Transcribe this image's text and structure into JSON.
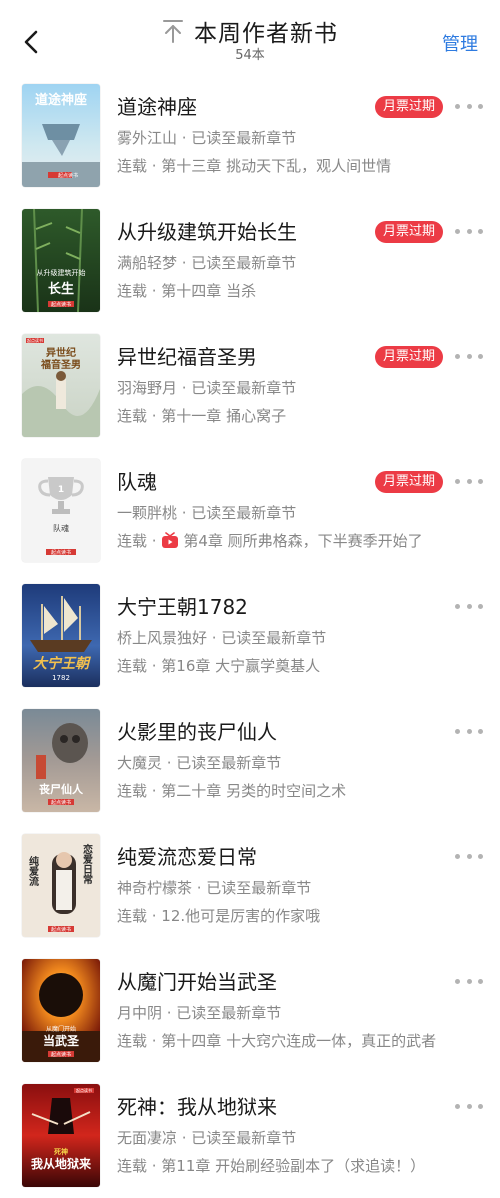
{
  "header": {
    "title": "本周作者新书",
    "count": "54本",
    "manage_label": "管理",
    "back_icon": "chevron-left-icon",
    "totop_icon": "arrow-up-bar-icon"
  },
  "colors": {
    "badge": "#ec3b45",
    "accent": "#2e7be0",
    "meta_text": "#888888"
  },
  "books": [
    {
      "title": "道途神座",
      "author_status": "雾外江山 · 已读至最新章节",
      "chapter": "连载 · 第十三章 挑动天下乱，观人间世情",
      "badge": "月票过期",
      "cover_text": "道途神座",
      "cover_logo": "起点读书",
      "video_icon": false
    },
    {
      "title": "从升级建筑开始长生",
      "author_status": "满船轻梦 · 已读至最新章节",
      "chapter": "连载 · 第十四章 当杀",
      "badge": "月票过期",
      "cover_text": "从升级建筑开始",
      "cover_text2": "长生",
      "cover_logo": "起点读书",
      "video_icon": false
    },
    {
      "title": "异世纪福音圣男",
      "author_status": "羽海野月 · 已读至最新章节",
      "chapter": "连载 · 第十一章 捅心窝子",
      "badge": "月票过期",
      "cover_text": "异世纪",
      "cover_text2": "福音圣男",
      "cover_logo": "起点读书",
      "video_icon": false
    },
    {
      "title": "队魂",
      "author_status": "一颗胖桃 · 已读至最新章节",
      "chapter": "第4章 厕所弗格森，下半赛季开始了",
      "chapter_prefix": "连载 · ",
      "badge": "月票过期",
      "cover_text": "队魂",
      "cover_logo": "起点读书",
      "video_icon": true
    },
    {
      "title": "大宁王朝1782",
      "author_status": "桥上风景独好 · 已读至最新章节",
      "chapter": "连载 · 第16章 大宁赢学奠基人",
      "badge": "",
      "cover_text": "大宁王朝",
      "cover_text2": "1782",
      "video_icon": false
    },
    {
      "title": "火影里的丧尸仙人",
      "author_status": "大魔灵 · 已读至最新章节",
      "chapter": "连载 · 第二十章 另类的时空间之术",
      "badge": "",
      "cover_text": "丧尸仙人",
      "cover_logo": "起点读书",
      "video_icon": false
    },
    {
      "title": "纯爱流恋爱日常",
      "author_status": "神奇柠檬茶 · 已读至最新章节",
      "chapter": "连载 · 12.他可是厉害的作家哦",
      "badge": "",
      "cover_text": "纯爱流",
      "cover_text2": "恋爱日常",
      "cover_logo": "起点读书",
      "video_icon": false
    },
    {
      "title": "从魔门开始当武圣",
      "author_status": "月中阴 · 已读至最新章节",
      "chapter": "连载 · 第十四章 十大窍穴连成一体，真正的武者",
      "badge": "",
      "cover_text": "从魔门开始",
      "cover_text2": "当武圣",
      "cover_logo": "起点读书",
      "video_icon": false
    },
    {
      "title": "死神：我从地狱来",
      "author_status": "无面凄凉 · 已读至最新章节",
      "chapter": "连载 · 第11章 开始刷经验副本了（求追读！）",
      "badge": "",
      "cover_text": "我从地狱来",
      "cover_text2": "死神",
      "cover_logo": "起点读书",
      "video_icon": false
    }
  ]
}
